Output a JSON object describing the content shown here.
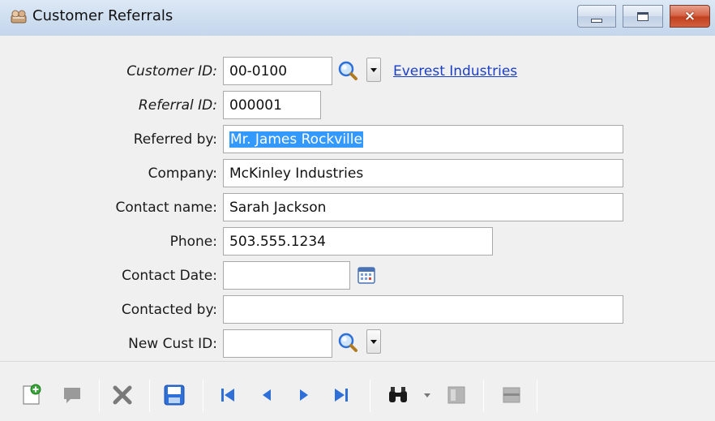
{
  "window": {
    "title": "Customer Referrals",
    "controls": {
      "minimize": "minimize",
      "maximize": "maximize",
      "close": "×"
    }
  },
  "form": {
    "customer_id": {
      "label": "Customer ID:",
      "value": "00-0100",
      "link": "Everest Industries"
    },
    "referral_id": {
      "label": "Referral ID:",
      "value": "000001"
    },
    "referred_by": {
      "label": "Referred by:",
      "value": "Mr. James Rockville"
    },
    "company": {
      "label": "Company:",
      "value": "McKinley Industries"
    },
    "contact_name": {
      "label": "Contact name:",
      "value": "Sarah Jackson"
    },
    "phone": {
      "label": "Phone:",
      "value": "503.555.1234"
    },
    "contact_date": {
      "label": "Contact Date:",
      "value": ""
    },
    "contacted_by": {
      "label": "Contacted by:",
      "value": ""
    },
    "new_cust_id": {
      "label": "New Cust ID:",
      "value": "  -"
    }
  },
  "toolbar": {
    "items": [
      "new-record-icon",
      "comment-icon",
      "delete-icon",
      "save-icon",
      "first-record-icon",
      "previous-record-icon",
      "next-record-icon",
      "last-record-icon",
      "find-icon",
      "panel-icon",
      "list-icon"
    ]
  },
  "colors": {
    "accent_blue": "#2e6fd8",
    "link": "#1a3fc6",
    "selection": "#3399ff",
    "close_red": "#c2411f"
  }
}
